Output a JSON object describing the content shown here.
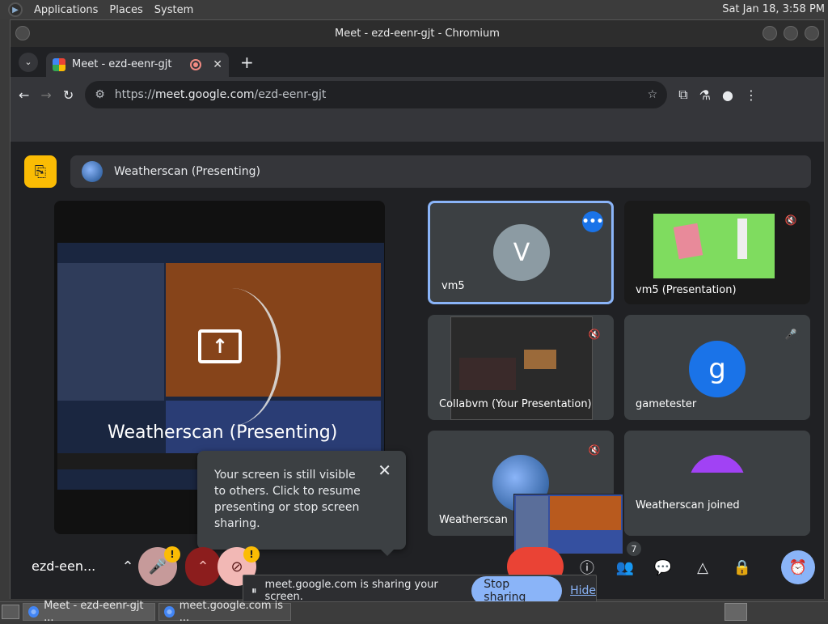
{
  "desktop": {
    "menu": [
      "Applications",
      "Places",
      "System"
    ],
    "clock": "Sat Jan 18,  3:58 PM"
  },
  "window": {
    "title": "Meet - ezd-eenr-gjt - Chromium"
  },
  "browser": {
    "tab_title": "Meet - ezd-eenr-gjt",
    "url_scheme": "https://",
    "url_host": "meet.google.com",
    "url_path": "/ezd-eenr-gjt"
  },
  "meet": {
    "presenting_label": "Weatherscan (Presenting)",
    "stage_label": "Weatherscan (Presenting)",
    "tiles": [
      {
        "name": "vm5",
        "avatar": "V",
        "avatar_color": "#8c9ba3"
      },
      {
        "name": "vm5 (Presentation)"
      },
      {
        "name": "Collabvm (Your Presentation)"
      },
      {
        "name": "gametester",
        "avatar": "g",
        "avatar_color": "#1a73e8"
      },
      {
        "name": "Weatherscan"
      },
      {
        "name": "Weatherscan joined",
        "avatar_color": "#a142f4"
      }
    ],
    "tooltip_text": "Your screen is still visible to others. Click to resume presenting or stop screen sharing.",
    "meeting_code": "ezd-een...",
    "participants_count": "7",
    "accent_color": "#8ab4f8"
  },
  "share_bar": {
    "message": "meet.google.com is sharing your screen.",
    "stop_label": "Stop sharing",
    "hide_label": "Hide"
  },
  "taskbar": {
    "items": [
      "Meet - ezd-eenr-gjt ...",
      "meet.google.com is ..."
    ]
  }
}
